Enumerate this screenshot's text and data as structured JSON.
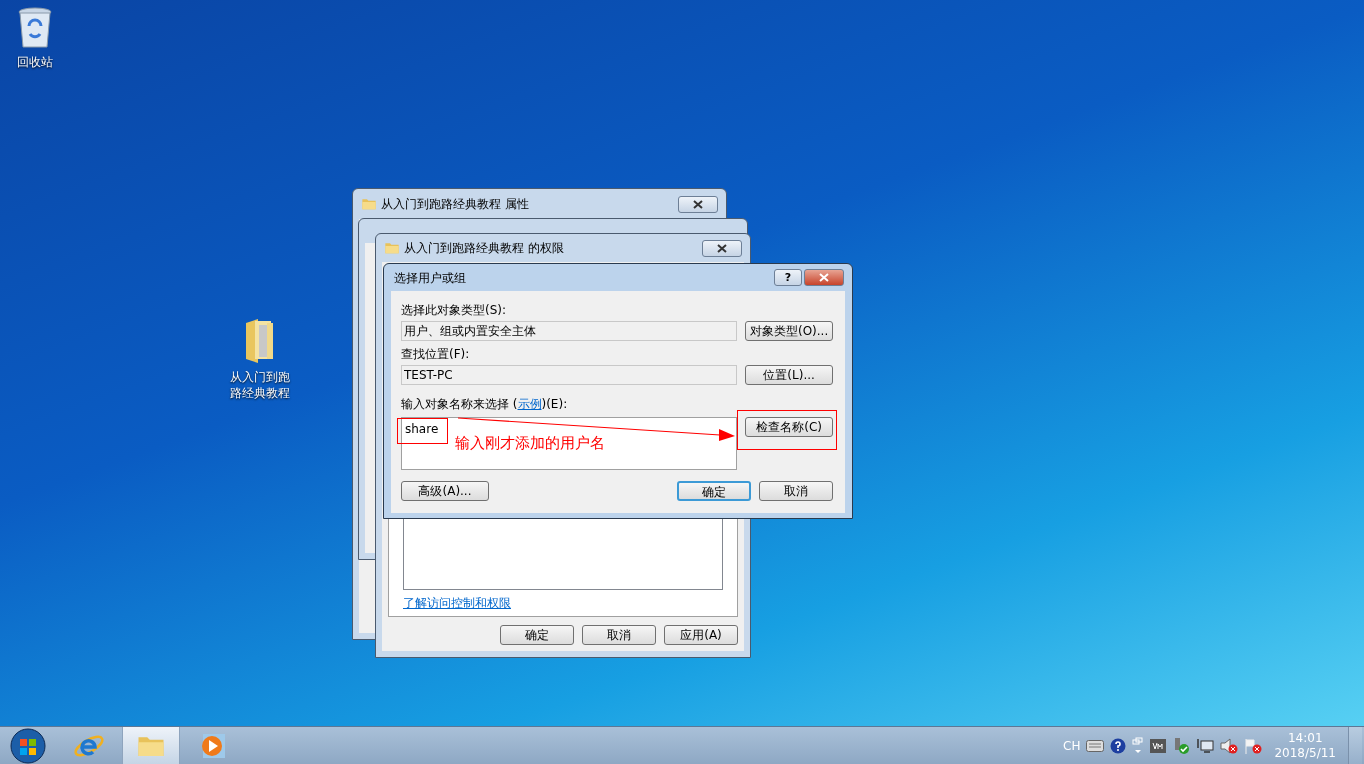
{
  "desktop_icons": [
    {
      "kind": "recycle-bin",
      "label": "回收站"
    },
    {
      "kind": "folder",
      "label": "从入门到跑路经典教程"
    }
  ],
  "properties_window": {
    "title": "从入门到跑路经典教程 属性"
  },
  "permissions_window": {
    "title": "从入门到跑路经典教程 的权限",
    "link": "了解访问控制和权限",
    "buttons": [
      {
        "label": "确定",
        "default": false
      },
      {
        "label": "取消",
        "default": false
      },
      {
        "label": "应用(A)",
        "default": false
      }
    ]
  },
  "select_dialog": {
    "title": "选择用户或组",
    "help": "?",
    "type_label": "选择此对象类型(S):",
    "type_value": "用户、组或内置安全主体",
    "type_button": "对象类型(O)...",
    "location_label": "查找位置(F):",
    "location_value": "TEST-PC",
    "location_button": "位置(L)...",
    "names_label_before": "输入对象名称来选择 (",
    "names_label_link": "示例",
    "names_label_after": ")(E):",
    "names_value": "share",
    "check_button": "检查名称(C)",
    "buttons": [
      {
        "label": "高级(A)...",
        "default": false
      },
      {
        "label": "确定",
        "default": true
      },
      {
        "label": "取消",
        "default": false
      }
    ]
  },
  "annotation": {
    "text": "输入刚才添加的用户名"
  },
  "taskbar": {
    "apps": [
      {
        "kind": "browser",
        "selected": false
      },
      {
        "kind": "explorer",
        "selected": true
      },
      {
        "kind": "media",
        "selected": false
      }
    ],
    "language": "CH",
    "time": "14:01",
    "date": "2018/5/11"
  }
}
